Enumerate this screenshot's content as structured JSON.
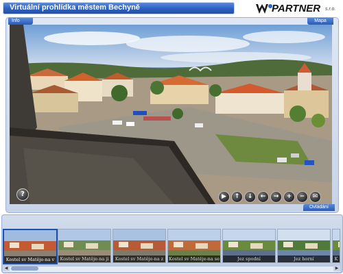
{
  "window": {
    "title": "Virtuální prohlídka městem Bechyně"
  },
  "logo": {
    "name": "PARTNER",
    "suffix": "s.r.o."
  },
  "tabs": {
    "info": "Info",
    "map": "Mapa",
    "controls": "Ovládání"
  },
  "help": {
    "label": "?"
  },
  "controls": [
    {
      "name": "play-icon",
      "glyph": "▶"
    },
    {
      "name": "arrow-up-icon",
      "glyph": "↑"
    },
    {
      "name": "arrow-down-icon",
      "glyph": "↓"
    },
    {
      "name": "arrow-left-icon",
      "glyph": "←"
    },
    {
      "name": "arrow-right-icon",
      "glyph": "→"
    },
    {
      "name": "zoom-in-icon",
      "glyph": "+"
    },
    {
      "name": "zoom-out-icon",
      "glyph": "−"
    },
    {
      "name": "mail-icon",
      "glyph": "✉"
    }
  ],
  "thumbnails": [
    {
      "label": "Kostel sv Matěje-na v",
      "selected": true
    },
    {
      "label": "Kostel sv Matěje-na ji",
      "selected": false
    },
    {
      "label": "Kostel sv Matěje-na z",
      "selected": false
    },
    {
      "label": "Kostel sv Matěje-na se",
      "selected": false
    },
    {
      "label": "Jez spodní",
      "selected": false
    },
    {
      "label": "Jez horní",
      "selected": false
    },
    {
      "label": "K",
      "selected": false
    }
  ],
  "colors": {
    "title_bar": "#2d5fc0",
    "frame": "#c7d3e7",
    "accent": "#1b4fb0"
  }
}
